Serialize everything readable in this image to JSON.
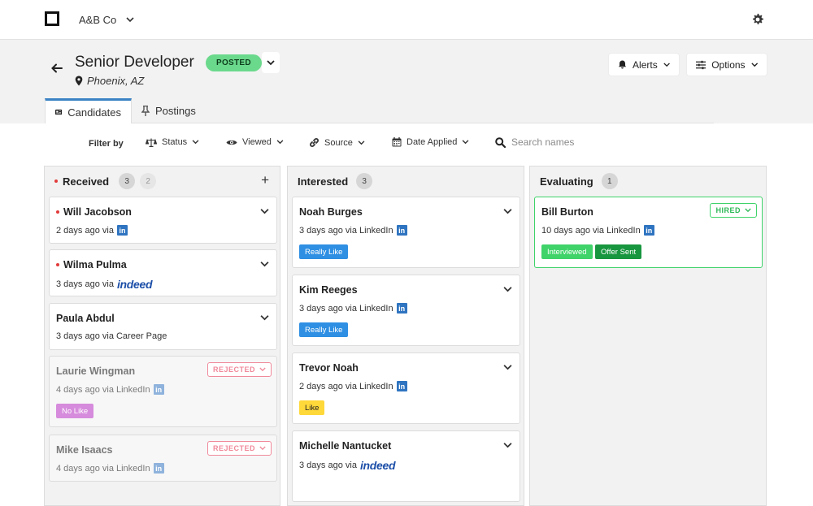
{
  "app": {
    "company": "A&B Co"
  },
  "job": {
    "title": "Senior Developer",
    "location": "Phoenix, AZ",
    "status": "POSTED"
  },
  "header_buttons": {
    "alerts": "Alerts",
    "options": "Options"
  },
  "tabs": [
    {
      "label": "Candidates"
    },
    {
      "label": "Postings"
    }
  ],
  "filters": {
    "label": "Filter by",
    "items": [
      {
        "label": "Status"
      },
      {
        "label": "Viewed"
      },
      {
        "label": "Source"
      },
      {
        "label": "Date Applied"
      }
    ],
    "search_placeholder": "Search names"
  },
  "columns": [
    {
      "title": "Received",
      "count": "3",
      "count2": "2",
      "cards": [
        {
          "name": "Will Jacobson",
          "meta": "2 days ago via",
          "source": "linkedin"
        },
        {
          "name": "Wilma Pulma",
          "meta": "3 days ago via",
          "source": "indeed"
        },
        {
          "name": "Paula Abdul",
          "meta": "3 days ago via Career Page",
          "source": ""
        },
        {
          "name": "Laurie Wingman",
          "meta": "4 days ago via LinkedIn",
          "source": "linkedin",
          "status": "REJECTED",
          "tag": "No Like"
        },
        {
          "name": "Mike Isaacs",
          "meta": "4 days ago via LinkedIn",
          "source": "linkedin",
          "status": "REJECTED"
        }
      ]
    },
    {
      "title": "Interested",
      "count": "3",
      "cards": [
        {
          "name": "Noah Burges",
          "meta": "3 days ago via LinkedIn",
          "source": "linkedin",
          "tag": "Really Like"
        },
        {
          "name": "Kim Reeges",
          "meta": "3 days ago via LinkedIn",
          "source": "linkedin",
          "tag": "Really Like"
        },
        {
          "name": "Trevor Noah",
          "meta": "2 days ago via LinkedIn",
          "source": "linkedin",
          "tag": "Like"
        },
        {
          "name": "Michelle Nantucket",
          "meta": "3 days ago via",
          "source": "indeed"
        }
      ]
    },
    {
      "title": "Evaluating",
      "count": "1",
      "cards": [
        {
          "name": "Bill Burton",
          "meta": "10 days ago via LinkedIn",
          "source": "linkedin",
          "status": "HIRED",
          "tags": [
            "Interviewed",
            "Offer Sent"
          ]
        }
      ]
    }
  ],
  "source_logos": {
    "linkedin": "in",
    "indeed": "indeed"
  },
  "colors": {
    "accent": "#3b82c4",
    "posted": "#6bd98c",
    "hired": "#3fd36a",
    "rejected": "#f08a9b",
    "unread_dot": "#e23a3a"
  }
}
